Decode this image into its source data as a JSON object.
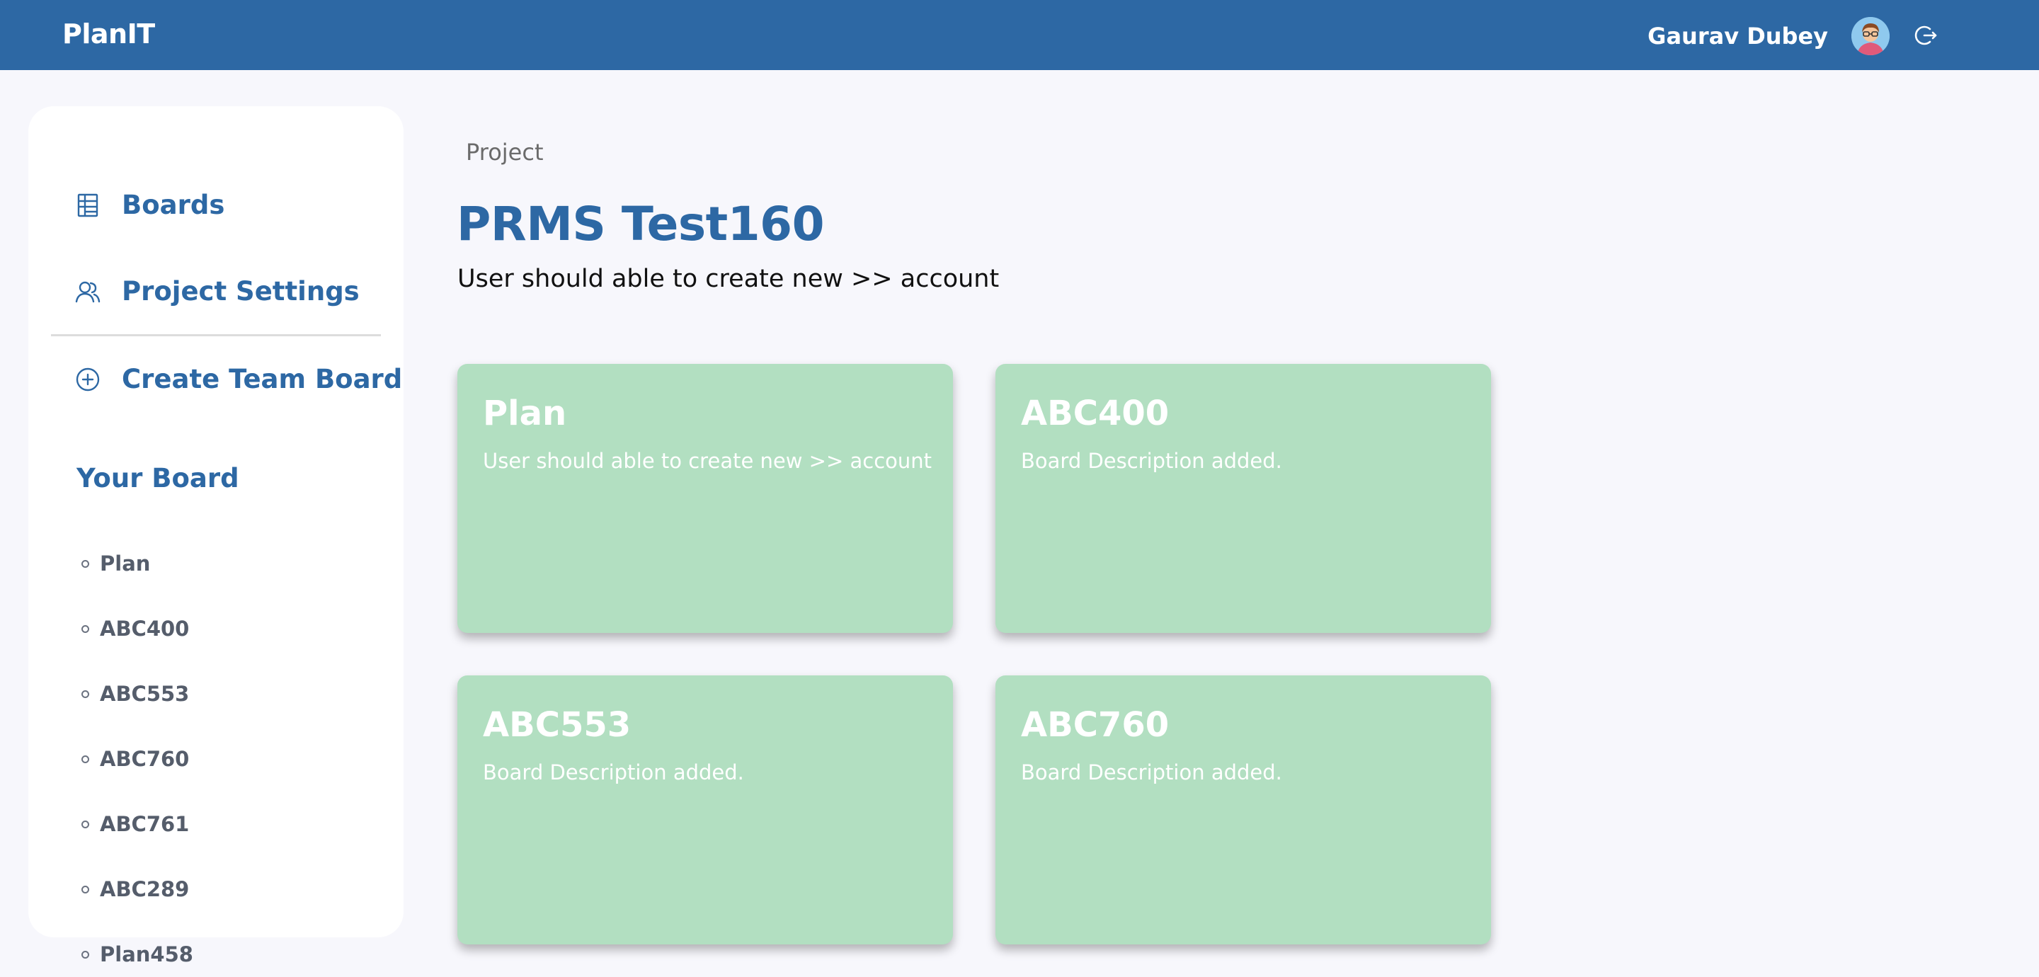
{
  "app": {
    "brand": "PlanIT",
    "user_name": "Gaurav Dubey",
    "accent_color": "#2d68a4",
    "card_color": "#b2dfc1",
    "icons": {
      "avatar": "user-avatar",
      "logout": "logout-icon"
    }
  },
  "sidebar": {
    "nav": [
      {
        "label": "Boards",
        "icon": "boards-grid-icon"
      },
      {
        "label": "Project Settings",
        "icon": "users-icon"
      },
      {
        "label": "Create Team Board",
        "icon": "plus-circle-icon"
      }
    ],
    "your_board_heading": "Your Board",
    "boards": [
      "Plan",
      "ABC400",
      "ABC553",
      "ABC760",
      "ABC761",
      "ABC289",
      "Plan458"
    ]
  },
  "main": {
    "breadcrumb": "Project",
    "title": "PRMS Test160",
    "description": "User should able to create new >> account",
    "cards": [
      {
        "title": "Plan",
        "description": "User should able to create new >> account"
      },
      {
        "title": "ABC400",
        "description": "Board Description added."
      },
      {
        "title": "ABC553",
        "description": "Board Description added."
      },
      {
        "title": "ABC760",
        "description": "Board Description added."
      }
    ]
  }
}
